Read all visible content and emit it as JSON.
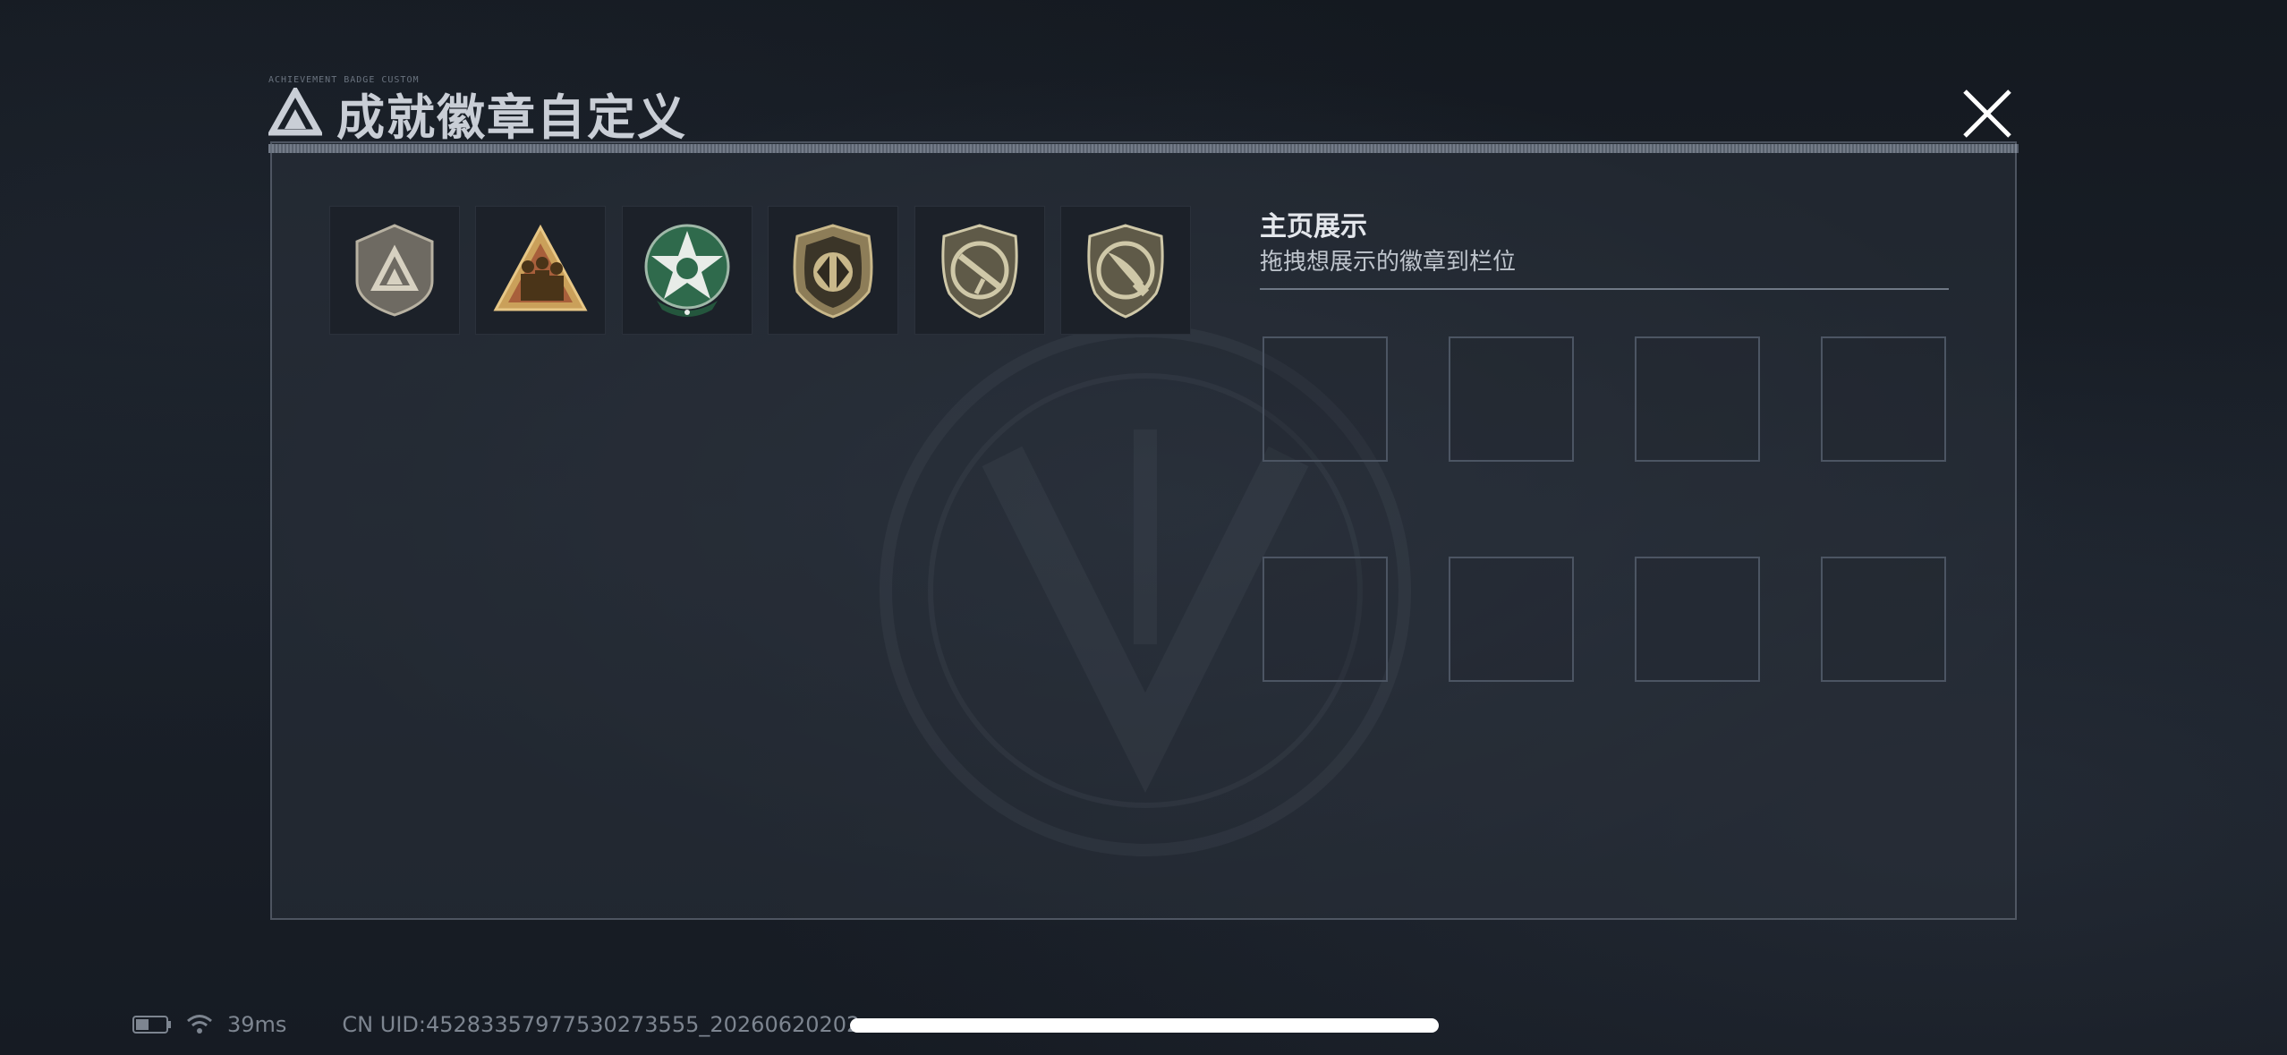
{
  "dialog": {
    "title": "成就徽章自定义",
    "micro_label": "ACHIEVEMENT BADGE CUSTOM",
    "close_icon": "close-icon"
  },
  "badges": [
    {
      "icon": "badge-shield-triangle-icon",
      "colors": {
        "bg": "#6e6a62",
        "fg": "#d7d1c1"
      }
    },
    {
      "icon": "badge-soldiers-triangle-icon",
      "colors": {
        "bg": "#caa05a",
        "fg": "#4a3418"
      }
    },
    {
      "icon": "badge-green-star-icon",
      "colors": {
        "bg": "#2f6a4c",
        "fg": "#e8ece8"
      }
    },
    {
      "icon": "badge-split-shield-icon",
      "colors": {
        "bg": "#8d7d58",
        "fg": "#2f2a20"
      }
    },
    {
      "icon": "badge-rifle-shield-icon",
      "colors": {
        "bg": "#5f5a48",
        "fg": "#cfc8a8"
      }
    },
    {
      "icon": "badge-knife-shield-icon",
      "colors": {
        "bg": "#5f5a48",
        "fg": "#cfc8a8"
      }
    }
  ],
  "display": {
    "title": "主页展示",
    "subtitle": "拖拽想展示的徽章到栏位"
  },
  "status": {
    "ping": "39ms",
    "uid": "CN UID:452833579775302735​55_20260620202",
    "battery_icon": "battery-icon",
    "wifi_icon": "wifi-icon"
  }
}
